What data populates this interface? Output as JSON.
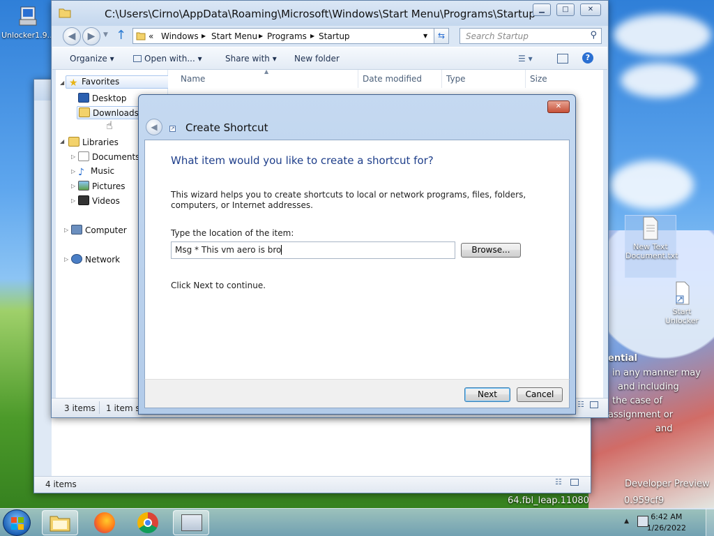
{
  "desktop": {
    "icons": [
      {
        "label": "Unlocker1.9..."
      },
      {
        "label": "New Text Document.txt"
      },
      {
        "label": "Start Unlocker"
      }
    ],
    "overlay_lines": [
      "ential",
      "in any manner may",
      "and including",
      "the case of",
      "assignment or",
      "and",
      "Developer Preview",
      "64.fbl_leap.11080",
      "0.959cf9"
    ]
  },
  "back_window": {
    "status": "4 items"
  },
  "explorer": {
    "title": "C:\\Users\\Cirno\\AppData\\Roaming\\Microsoft\\Windows\\Start Menu\\Programs\\Startup",
    "breadcrumb": [
      "«",
      "Windows",
      "Start Menu",
      "Programs",
      "Startup"
    ],
    "search_placeholder": "Search Startup",
    "toolbar": {
      "organize": "Organize",
      "open_with": "Open with...",
      "share_with": "Share with",
      "new_folder": "New folder"
    },
    "nav": {
      "favorites": "Favorites",
      "desktop": "Desktop",
      "downloads": "Downloads",
      "libraries": "Libraries",
      "documents": "Documents",
      "music": "Music",
      "pictures": "Pictures",
      "videos": "Videos",
      "computer": "Computer",
      "network": "Network"
    },
    "columns": {
      "name": "Name",
      "date_modified": "Date modified",
      "type": "Type",
      "size": "Size"
    },
    "status": {
      "items": "3 items",
      "selected": "1 item se"
    }
  },
  "dialog": {
    "title": "Create Shortcut",
    "heading": "What item would you like to create a shortcut for?",
    "description": "This wizard helps you to create shortcuts to local or network programs, files, folders, computers, or Internet addresses.",
    "location_label": "Type the location of the item:",
    "location_value": "Msg * This vm aero is bro",
    "browse_label": "Browse...",
    "hint": "Click Next to continue.",
    "next_label": "Next",
    "cancel_label": "Cancel"
  },
  "taskbar": {
    "time": "6:42 AM",
    "date": "1/26/2022"
  },
  "colors": {
    "accent_heading": "#1e3e8a",
    "title_bar": "#c4d7ee",
    "close_red": "#c75139"
  }
}
